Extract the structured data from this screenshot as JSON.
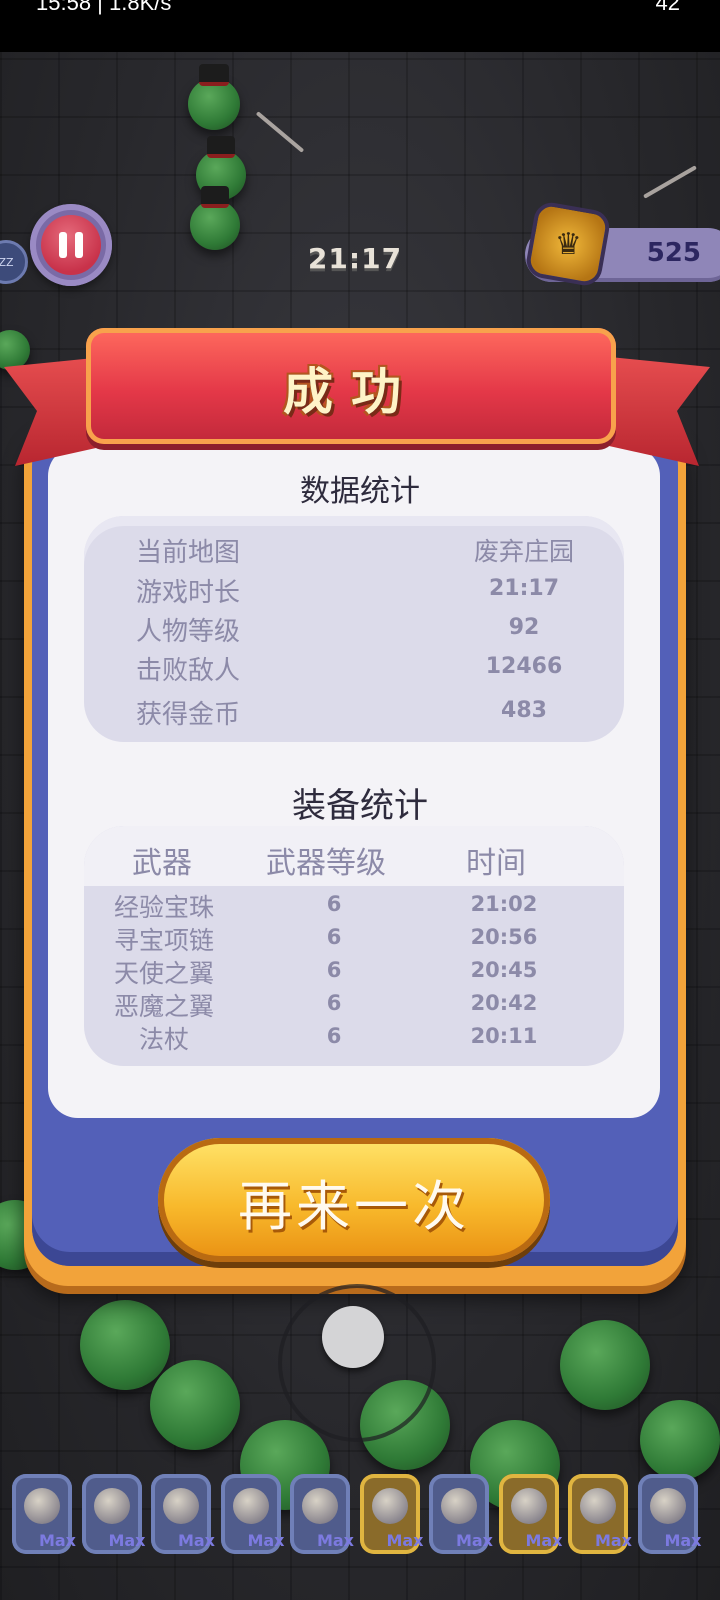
{
  "status_bar": {
    "left": "15:58 | 1.8K/s",
    "right": "42"
  },
  "hud": {
    "timer": "21:17",
    "coins": "525",
    "side_badge": "ZZ"
  },
  "dialog": {
    "title": "成功",
    "stats_title": "数据统计",
    "stats": [
      {
        "label": "当前地图",
        "value": "废弃庄园"
      },
      {
        "label": "游戏时长",
        "value": "21:17"
      },
      {
        "label": "人物等级",
        "value": "92"
      },
      {
        "label": "击败敌人",
        "value": "12466"
      },
      {
        "label": "获得金币",
        "value": "483"
      }
    ],
    "equip_title": "装备统计",
    "equip_headers": [
      "武器",
      "武器等级",
      "时间"
    ],
    "equipment": [
      {
        "name": "经验宝珠",
        "level": "6",
        "time": "21:02"
      },
      {
        "name": "寻宝项链",
        "level": "6",
        "time": "20:56"
      },
      {
        "name": "天使之翼",
        "level": "6",
        "time": "20:45"
      },
      {
        "name": "恶魔之翼",
        "level": "6",
        "time": "20:42"
      },
      {
        "name": "法杖",
        "level": "6",
        "time": "20:11"
      }
    ],
    "retry_label": "再来一次"
  },
  "skills": [
    {
      "icon": "orb-icon",
      "label": "Max",
      "tier": "blue"
    },
    {
      "icon": "necklace-icon",
      "label": "Max",
      "tier": "blue"
    },
    {
      "icon": "angel-wings-icon",
      "label": "Max",
      "tier": "blue"
    },
    {
      "icon": "demon-wings-icon",
      "label": "Max",
      "tier": "blue"
    },
    {
      "icon": "staff-icon",
      "label": "Max",
      "tier": "blue"
    },
    {
      "icon": "treasure-icon",
      "label": "Max",
      "tier": "gold"
    },
    {
      "icon": "crystal-icon",
      "label": "Max",
      "tier": "blue"
    },
    {
      "icon": "shield-icon",
      "label": "Max",
      "tier": "gold"
    },
    {
      "icon": "ring-icon",
      "label": "Max",
      "tier": "gold"
    },
    {
      "icon": "gem-icon",
      "label": "Max",
      "tier": "blue"
    }
  ]
}
